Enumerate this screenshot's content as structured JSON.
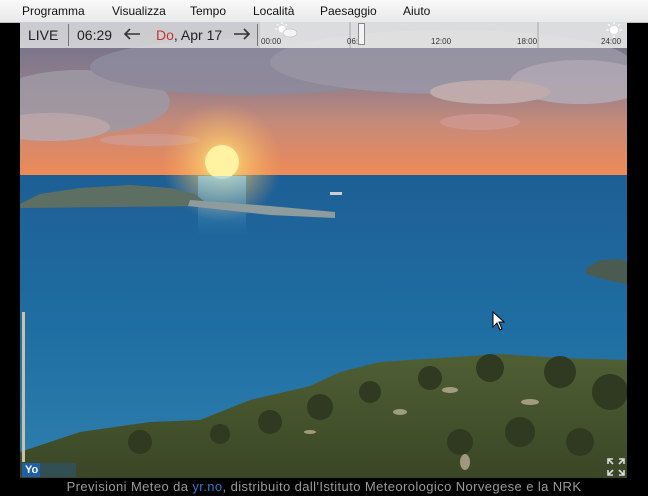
{
  "menu": {
    "items": [
      {
        "label": "Programma"
      },
      {
        "label": "Visualizza"
      },
      {
        "label": "Tempo"
      },
      {
        "label": "Località"
      },
      {
        "label": "Paesaggio"
      },
      {
        "label": "Aiuto"
      }
    ]
  },
  "timebar": {
    "live_label": "LIVE",
    "time": "06:29",
    "day": "Do",
    "date": ", Apr 17",
    "ticks": [
      "00:00",
      "06:",
      "12:00",
      "18:00",
      "24:00"
    ]
  },
  "footer": {
    "prefix": "Previsioni Meteo da ",
    "link": "yr.no",
    "suffix": ", distribuito dall'Istituto Meteorologico Norvegese e la NRK"
  },
  "logo": {
    "text": "Yo"
  },
  "colors": {
    "menubar": "#eeeeee",
    "day_accent": "#c0392b",
    "link": "#3a78c8",
    "sea": "#1a5f96",
    "sunset": "#e8845a"
  },
  "icons": [
    "sun-cloud-icon",
    "sun-icon",
    "arrow-left-icon",
    "arrow-right-icon",
    "fullscreen-icon",
    "mouse-cursor-icon"
  ]
}
